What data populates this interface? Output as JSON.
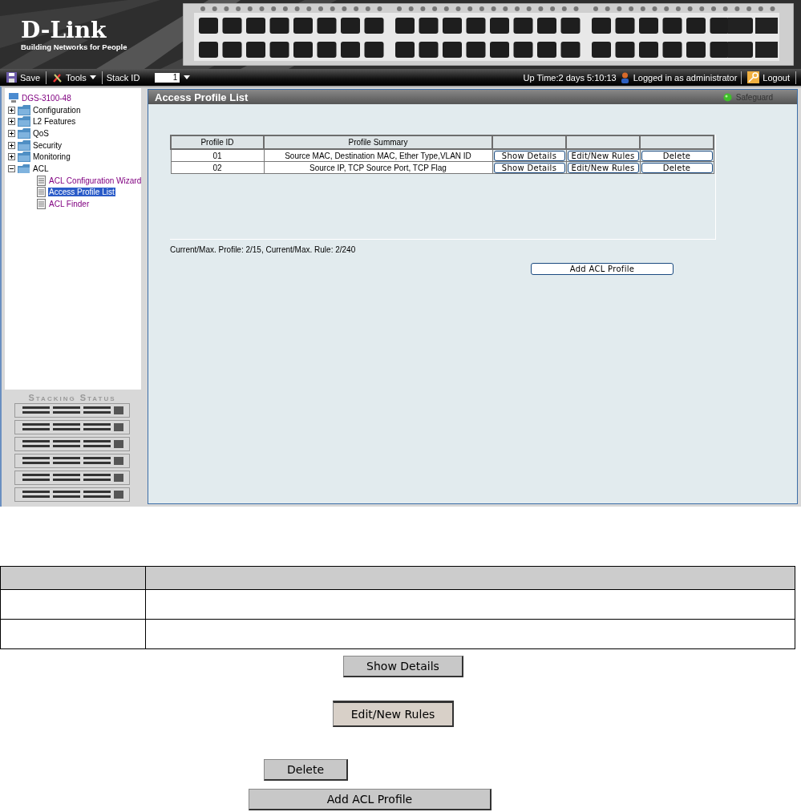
{
  "header": {
    "logo": "D-Link",
    "tagline": "Building Networks for People"
  },
  "toolbar": {
    "save": "Save",
    "tools": "Tools",
    "stack_id_label": "Stack ID",
    "stack_id": "1",
    "uptime": "Up Time:2 days 5:10:13",
    "user": "Logged in as administrator",
    "logout": "Logout"
  },
  "tree": {
    "label": "DGS-3100-48",
    "children": [
      {
        "label": "Configuration",
        "expanded": false
      },
      {
        "label": "L2 Features",
        "expanded": false
      },
      {
        "label": "QoS",
        "expanded": false
      },
      {
        "label": "Security",
        "expanded": false
      },
      {
        "label": "Monitoring",
        "expanded": false
      },
      {
        "label": "ACL",
        "expanded": true,
        "children": [
          {
            "label": "ACL Configuration Wizard",
            "selected": false
          },
          {
            "label": "Access Profile List",
            "selected": true
          },
          {
            "label": "ACL Finder",
            "selected": false
          }
        ]
      }
    ]
  },
  "stacking_status": {
    "title": "Stacking Status"
  },
  "panel": {
    "title": "Access Profile List",
    "safeguard": "Safeguard"
  },
  "table": {
    "columns": [
      "Profile ID",
      "Profile Summary"
    ],
    "rows": [
      {
        "profile_id": "01",
        "summary": "Source MAC, Destination MAC, Ether Type,VLAN ID",
        "actions": [
          "Show Details",
          "Edit/New Rules",
          "Delete"
        ]
      },
      {
        "profile_id": "02",
        "summary": "Source IP, TCP Source Port, TCP Flag",
        "actions": [
          "Show Details",
          "Edit/New Rules",
          "Delete"
        ]
      }
    ]
  },
  "counts": "Current/Max. Profile: 2/15, Current/Max. Rule: 2/240",
  "add_button": "Add ACL Profile",
  "doc_buttons": [
    {
      "label": "Show Details",
      "kind": "plain"
    },
    {
      "label": "Edit/New Rules",
      "kind": "pressed"
    },
    {
      "label": "Delete",
      "kind": "plain"
    },
    {
      "label": "Add ACL Profile",
      "kind": "plain"
    }
  ]
}
